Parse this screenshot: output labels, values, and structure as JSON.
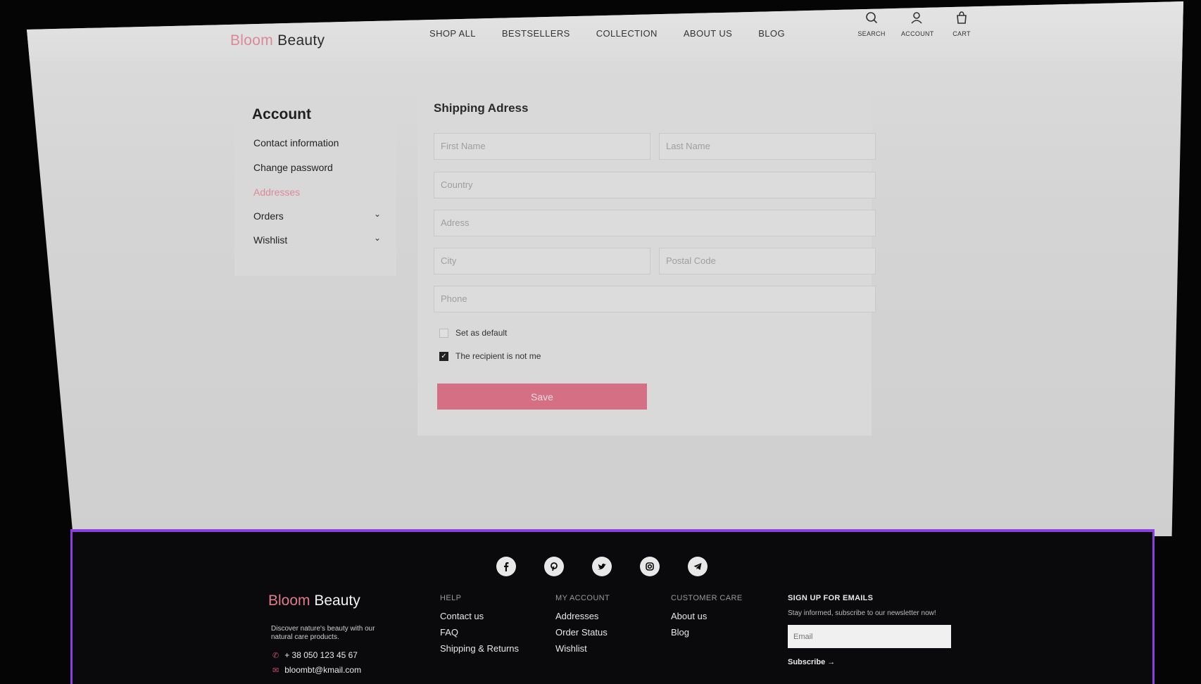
{
  "brand": {
    "part1": "Bloom",
    "part2": "Beauty"
  },
  "nav": [
    "SHOP ALL",
    "BESTSELLERS",
    "COLLECTION",
    "ABOUT US",
    "BLOG"
  ],
  "header_icons": [
    {
      "icon": "search-icon",
      "label": "SEARCH"
    },
    {
      "icon": "account-icon",
      "label": "ACCOUNT"
    },
    {
      "icon": "cart-icon",
      "label": "CART"
    }
  ],
  "sidebar": {
    "title": "Account",
    "items": [
      {
        "label": "Contact information"
      },
      {
        "label": "Change password"
      },
      {
        "label": "Addresses",
        "active": true
      },
      {
        "label": "Orders",
        "expandable": true
      },
      {
        "label": "Wishlist",
        "expandable": true
      }
    ]
  },
  "shipping": {
    "title": "Shipping Adress",
    "fields": {
      "first_name": "First Name",
      "last_name": "Last Name",
      "country": "Country",
      "address": "Adress",
      "city": "City",
      "postal_code": "Postal Code",
      "phone": "Phone"
    },
    "checkboxes": [
      {
        "label": "Set as default",
        "checked": false
      },
      {
        "label": "The recipient is not me",
        "checked": true
      }
    ],
    "save_label": "Save"
  },
  "footer": {
    "social": [
      "facebook-icon",
      "pinterest-icon",
      "twitter-icon",
      "instagram-icon",
      "telegram-icon"
    ],
    "description": "Discover nature's beauty with our natural care products.",
    "phone": "+ 38 050 123 45 67",
    "email": "bloombt@kmail.com",
    "columns": [
      {
        "title": "HELP",
        "links": [
          "Contact us",
          "FAQ",
          "Shipping & Returns"
        ]
      },
      {
        "title": "MY ACCOUNT",
        "links": [
          "Addresses",
          "Order Status",
          "Wishlist"
        ]
      },
      {
        "title": "CUSTOMER CARE",
        "links": [
          "About us",
          "Blog"
        ]
      }
    ],
    "newsletter": {
      "title": "SIGN UP FOR EMAILS",
      "text": "Stay informed, subscribe to our newsletter now!",
      "placeholder": "Email",
      "button": "Subscribe →"
    }
  },
  "colors": {
    "accent": "#d46f84",
    "footer_border": "#8a3fe0"
  }
}
